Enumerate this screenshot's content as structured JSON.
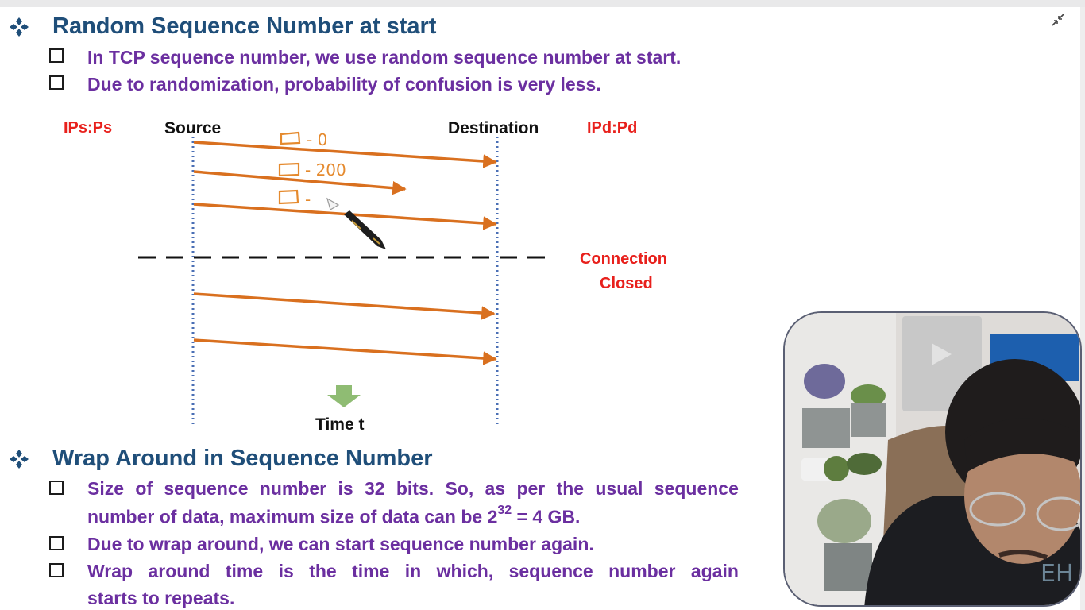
{
  "section1": {
    "heading": "Random Sequence Number at start",
    "bullets": [
      "In TCP sequence number, we use random sequence number at start.",
      "Due to randomization, probability of confusion is very less."
    ]
  },
  "diagram": {
    "source_addr": "IPs:Ps",
    "source_label": "Source",
    "destination_label": "Destination",
    "destination_addr": "IPd:Pd",
    "connection_closed_line1": "Connection",
    "connection_closed_line2": "Closed",
    "time_label": "Time t",
    "handwritten": [
      "- 0",
      "- 200",
      "-"
    ]
  },
  "section2": {
    "heading": "Wrap Around in Sequence Number",
    "bullet1_line1_words": [
      "Size",
      "of",
      "sequence",
      "number",
      "is",
      "32",
      "bits.",
      "So,",
      "as",
      "per",
      "the",
      "usual",
      "sequence"
    ],
    "bullet1_line2_prefix": "number of data, maximum size of data can be 2",
    "bullet1_line2_exponent": "32",
    "bullet1_line2_suffix": " = 4 GB.",
    "bullet2": "Due to wrap around, we can start sequence number again.",
    "bullet3_line1_words": [
      "Wrap",
      "around",
      "time",
      "is",
      "the",
      "time",
      "in",
      "which,",
      "sequence",
      "number",
      "again"
    ],
    "bullet3_line2": "starts to repeats."
  },
  "colors": {
    "heading": "#1f4e79",
    "bullet_text": "#6b2fa0",
    "arrows": "#d9701f",
    "red_labels": "#e8201c",
    "timelines": "#4a6fb5"
  }
}
